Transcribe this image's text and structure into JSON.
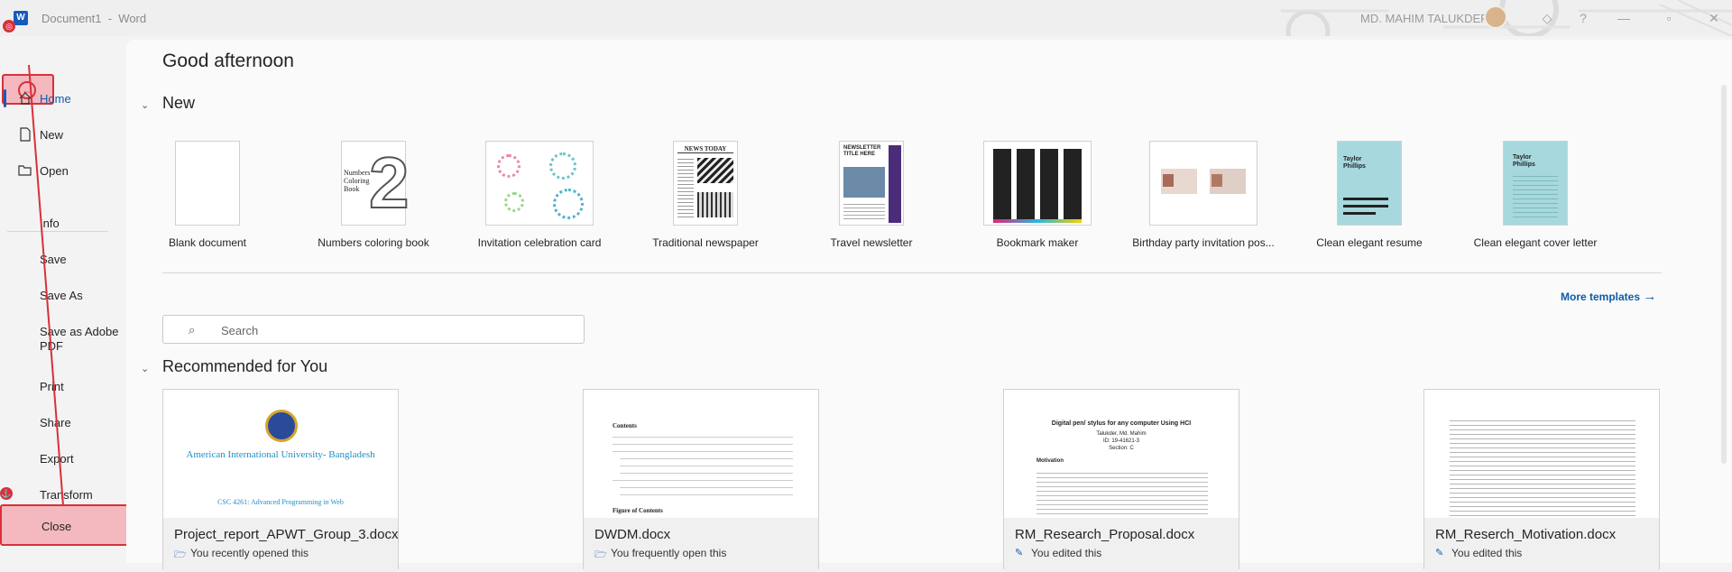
{
  "titlebar": {
    "doc_title": "Document1",
    "separator": "-",
    "app_name": "Word",
    "user_name": "MD. MAHIM TALUKDER",
    "help": "?"
  },
  "sidebar": {
    "items": [
      {
        "label": "Home",
        "icon": "home-icon",
        "active": true
      },
      {
        "label": "New",
        "icon": "new-document-icon"
      },
      {
        "label": "Open",
        "icon": "folder-open-icon"
      },
      {
        "label": "Info"
      },
      {
        "label": "Save"
      },
      {
        "label": "Save As"
      },
      {
        "label": "Save as Adobe PDF"
      },
      {
        "label": "Print"
      },
      {
        "label": "Share"
      },
      {
        "label": "Export"
      },
      {
        "label": "Transform"
      }
    ],
    "close_label": "Close"
  },
  "main": {
    "greeting": "Good afternoon",
    "new_section": "New",
    "templates": [
      {
        "label": "Blank document"
      },
      {
        "label": "Numbers coloring book"
      },
      {
        "label": "Invitation celebration card"
      },
      {
        "label": "Traditional newspaper"
      },
      {
        "label": "Travel newsletter"
      },
      {
        "label": "Bookmark maker"
      },
      {
        "label": "Birthday party invitation pos..."
      },
      {
        "label": "Clean elegant resume"
      },
      {
        "label": "Clean elegant cover letter"
      }
    ],
    "more_templates": "More templates",
    "search_placeholder": "Search",
    "recommended_section": "Recommended for You",
    "docs": [
      {
        "name": "Project_report_APWT_Group_3.docx",
        "sub": "You recently opened this",
        "icon": "folder-open-icon"
      },
      {
        "name": "DWDM.docx",
        "sub": "You frequently open this",
        "icon": "folder-open-icon"
      },
      {
        "name": "RM_Research_Proposal.docx",
        "sub": "You edited this",
        "icon": "pencil-icon"
      },
      {
        "name": "RM_Reserch_Motivation.docx",
        "sub": "You edited this",
        "icon": "pencil-icon"
      }
    ],
    "previews": {
      "aiub_title": "American International University- Bangladesh",
      "aiub_course": "CSC 4261: Advanced Programming in Web",
      "dwdm_heading": "Contents",
      "dwdm_figures": "Figure of Contents",
      "rm_title": "Digital pen/ stylus for any computer Using HCI",
      "rm_author": "Talukder, Md. Mahim",
      "rm_id": "ID: 19-41621-3",
      "rm_section": "Section: C",
      "rm_motivation": "Motivation",
      "newsletter_title": "NEWSLETTER TITLE HERE",
      "newspaper_title": "NEWS TODAY",
      "resume_name": "Taylor Phillips",
      "coloring_text": "Numbers Coloring Book"
    }
  },
  "colors": {
    "accent": "#185abd",
    "annotation_red": "#d9303a",
    "annotation_fill": "#f4b9be"
  }
}
